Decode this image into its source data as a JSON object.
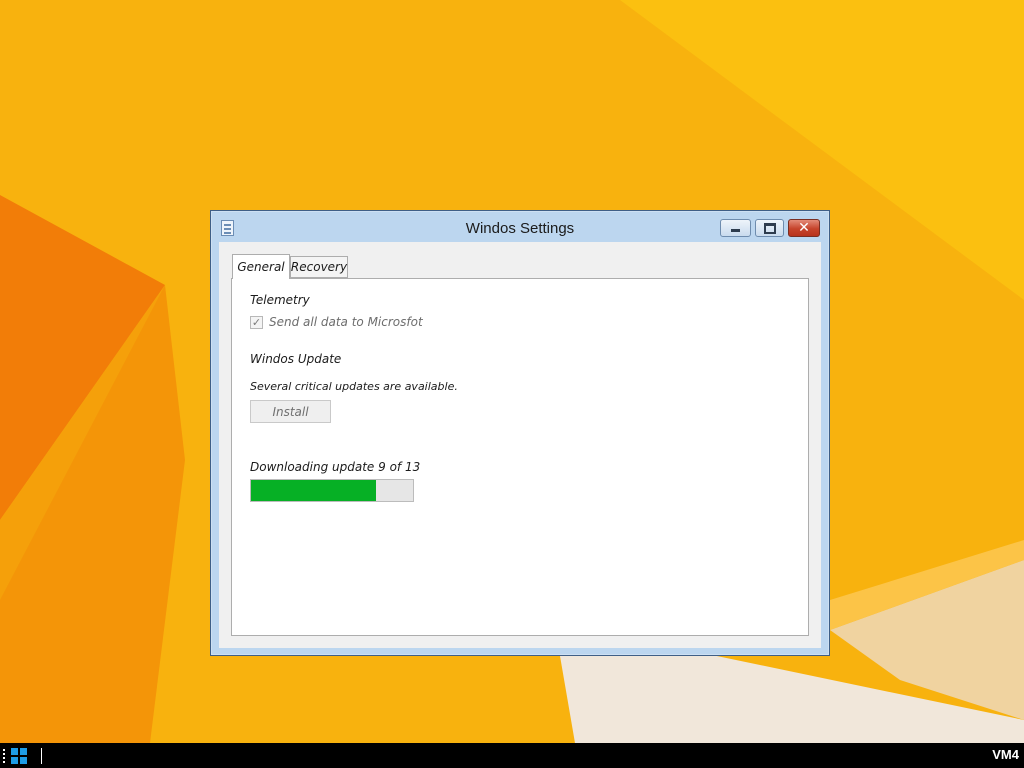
{
  "window": {
    "title": "Windos Settings",
    "controls": {
      "minimize": "minimize-icon",
      "maximize": "maximize-icon",
      "close": "close-icon"
    }
  },
  "tabs": [
    {
      "label": "General",
      "selected": true
    },
    {
      "label": "Recovery",
      "selected": false
    }
  ],
  "general": {
    "telemetry_heading": "Telemetry",
    "telemetry_checkbox": {
      "label": "Send all data to Microsfot",
      "checked": true,
      "disabled": true
    },
    "update_heading": "Windos Update",
    "update_message": "Several critical updates are available.",
    "install_label": "Install",
    "progress_text": "Downloading update 9 of 13",
    "progress_value": 0.77
  },
  "taskbar": {
    "vm_label": "VM4",
    "start_icon": "windows-logo-icon"
  },
  "colors": {
    "desktop": "#f8b20e",
    "progress": "#06b025",
    "window_frame": "#bcd6ef",
    "close_button": "#c6442c"
  }
}
